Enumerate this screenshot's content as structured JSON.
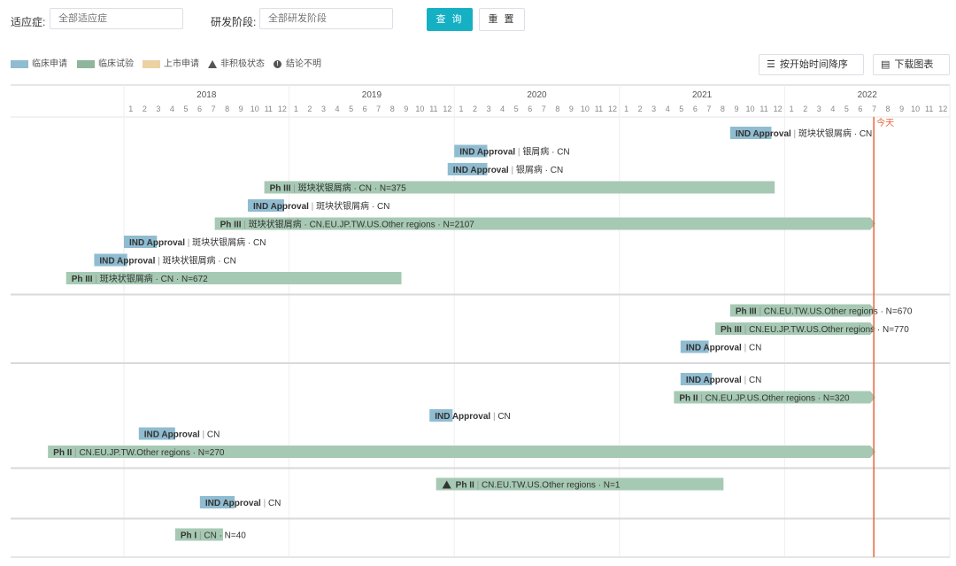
{
  "filters": {
    "indication_label": "适应症:",
    "indication_placeholder": "全部适应症",
    "stage_label": "研发阶段:",
    "stage_placeholder": "全部研发阶段",
    "search_button": "查 询",
    "reset_button": "重 置"
  },
  "legend": {
    "clinical_application": "临床申请",
    "clinical_trial": "临床试验",
    "market_application": "上市申请",
    "inactive_status": "非积极状态",
    "unclear_conclusion": "结论不明"
  },
  "toolbar": {
    "sort_button": "按开始时间降序",
    "download_button": "下载图表"
  },
  "colors": {
    "clinical_application": "#8fbcd1",
    "clinical_trial": "#a6c9b3",
    "market_application": "#ebd1a3",
    "today_line": "#e8643c"
  },
  "chart_data": {
    "type": "gantt",
    "years": [
      "2018",
      "2019",
      "2020",
      "2021",
      "2022"
    ],
    "months": [
      "1",
      "2",
      "3",
      "4",
      "5",
      "6",
      "7",
      "8",
      "9",
      "10",
      "11",
      "12"
    ],
    "today_label": "今天",
    "today": 2022.54,
    "groups": [
      {
        "rows": [
          {
            "type": "application",
            "start": 2021.67,
            "end": 2021.92,
            "bold": "IND Approval",
            "detail": "斑块状银屑病 · CN"
          },
          {
            "type": "application",
            "start": 2020.0,
            "end": 2020.2,
            "bold": "IND Approval",
            "detail": "银屑病 · CN"
          },
          {
            "type": "application",
            "start": 2019.96,
            "end": 2020.2,
            "bold": "IND Approval",
            "detail": "银屑病 · CN"
          },
          {
            "type": "trial",
            "start": 2018.85,
            "end": 2021.94,
            "bold": "Ph III",
            "detail": "斑块状银屑病 · CN · N=375"
          },
          {
            "type": "application",
            "start": 2018.75,
            "end": 2018.97,
            "bold": "IND Approval",
            "detail": "斑块状银屑病 · CN"
          },
          {
            "type": "trial",
            "start": 2018.55,
            "end": 2022.55,
            "bold": "Ph III",
            "detail": "斑块状银屑病 · CN.EU.JP.TW.US.Other regions · N=2107",
            "arrow": true
          },
          {
            "type": "application",
            "start": 2018.0,
            "end": 2018.2,
            "bold": "IND Approval",
            "detail": "斑块状银屑病 · CN"
          },
          {
            "type": "application",
            "start": 2017.82,
            "end": 2018.02,
            "bold": "IND Approval",
            "detail": "斑块状银屑病 · CN"
          },
          {
            "type": "trial",
            "start": 2017.65,
            "end": 2019.68,
            "bold": "Ph III",
            "detail": "斑块状银屑病 · CN · N=672"
          }
        ]
      },
      {
        "rows": [
          {
            "type": "trial",
            "start": 2021.67,
            "end": 2022.55,
            "bold": "Ph III",
            "detail": "CN.EU.TW.US.Other regions · N=670",
            "arrow": true
          },
          {
            "type": "trial",
            "start": 2021.58,
            "end": 2022.55,
            "bold": "Ph III",
            "detail": "CN.EU.JP.TW.US.Other regions · N=770",
            "arrow": true
          },
          {
            "type": "application",
            "start": 2021.37,
            "end": 2021.54,
            "bold": "IND Approval",
            "detail": "CN"
          }
        ]
      },
      {
        "rows": [
          {
            "type": "application",
            "start": 2021.37,
            "end": 2021.56,
            "bold": "IND Approval",
            "detail": "CN"
          },
          {
            "type": "trial",
            "start": 2021.33,
            "end": 2022.55,
            "bold": "Ph II",
            "detail": "CN.EU.JP.US.Other regions · N=320",
            "arrow": true
          },
          {
            "type": "application",
            "start": 2019.85,
            "end": 2019.99,
            "bold": "IND Approval",
            "detail": "CN"
          },
          {
            "type": "application",
            "start": 2018.09,
            "end": 2018.31,
            "bold": "IND Approval",
            "detail": "CN"
          },
          {
            "type": "trial",
            "start": 2017.54,
            "end": 2022.55,
            "bold": "Ph II",
            "detail": "CN.EU.JP.TW.Other regions · N=270",
            "arrow": true
          }
        ]
      },
      {
        "rows": [
          {
            "type": "trial",
            "start": 2019.89,
            "end": 2021.63,
            "bold": "Ph II",
            "detail": "CN.EU.TW.US.Other regions · N=1",
            "inactive": true
          },
          {
            "type": "application",
            "start": 2018.46,
            "end": 2018.67,
            "bold": "IND Approval",
            "detail": "CN"
          }
        ]
      },
      {
        "rows": [
          {
            "type": "trial",
            "start": 2018.31,
            "end": 2018.6,
            "bold": "Ph I",
            "detail": "CN · N=40"
          }
        ]
      }
    ]
  }
}
